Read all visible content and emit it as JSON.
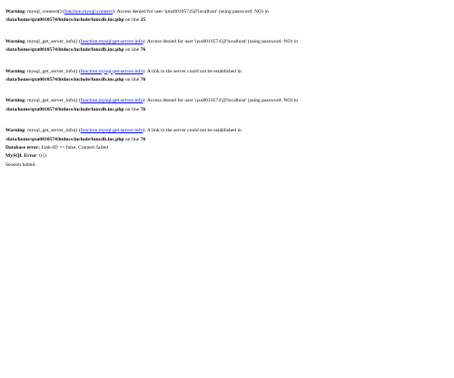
{
  "warnings": [
    {
      "label": "Warning",
      "func": "mysql_connect()",
      "link": "function.mysql-connect",
      "msg": ": Access denied for user 'qmz0010574'@'localhost' (using password: NO) in",
      "file": "/data/home/qxu0010574/htdocs/include/funcdb.inc.php",
      "line_prefix": " on line ",
      "line": "25"
    },
    {
      "label": "Warning",
      "func": "mysql_get_server_info()",
      "link": "function.mysql-get-server-info",
      "msg": ": Access denied for user 'qxu0010574'@'localhost' (using password: NO) in",
      "file": "/data/home/qxu0010574/htdocs/include/funcdb.inc.php",
      "line_prefix": " on line ",
      "line": "76"
    },
    {
      "label": "Warning",
      "func": "mysql_get_server_info()",
      "link": "function.mysql-get-server-info",
      "msg": ": A link to the server could not be established in",
      "file": "/data/home/qxu0010574/htdocs/include/funcdb.inc.php",
      "line_prefix": " on line ",
      "line": "76"
    },
    {
      "label": "Warning",
      "func": "mysql_get_server_info()",
      "link": "function.mysql-get-server-info",
      "msg": ": Access denied for user 'qxu0010574'@'localhost' (using password: NO) in",
      "file": "/data/home/qxu0010574/htdocs/include/funcdb.inc.php",
      "line_prefix": " on line ",
      "line": "76"
    },
    {
      "label": "Warning",
      "func": "mysql_get_server_info()",
      "link": "function.mysql-get-server-info",
      "msg": ": A link to the server could not be established in",
      "file": "/data/home/qxu0010574/htdocs/include/funcdb.inc.php",
      "line_prefix": " on line ",
      "line": "76"
    }
  ],
  "db_error": {
    "label": "Database error:",
    "text": " Link-ID == false, Connect failed"
  },
  "mysql_error": {
    "label": "MySQL Error",
    "text": ": 0 ()"
  },
  "session_halted": "Session halted."
}
